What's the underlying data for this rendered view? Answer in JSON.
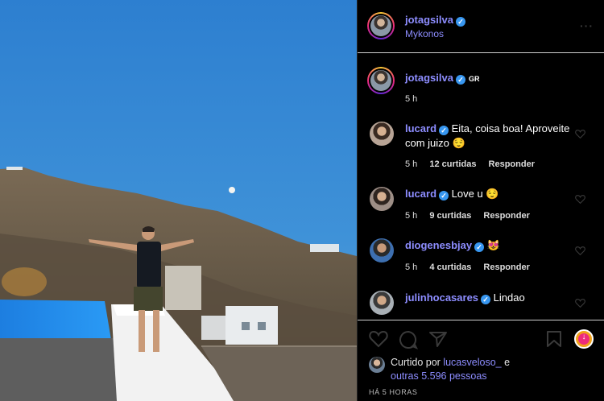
{
  "post": {
    "author": "jotagsilva",
    "location": "Mykonos",
    "more_icon": "more-horizontal-icon"
  },
  "caption": {
    "author": "jotagsilva",
    "badge": "GR",
    "time": "5 h"
  },
  "comments": [
    {
      "user": "lucard",
      "verified": true,
      "text": "Eita, coisa boa! Aproveite com juizo 😌",
      "time": "5 h",
      "likes": "12 curtidas",
      "reply": "Responder"
    },
    {
      "user": "lucard",
      "verified": true,
      "text": "Love u 😌",
      "time": "5 h",
      "likes": "9 curtidas",
      "reply": "Responder"
    },
    {
      "user": "diogenesbjay",
      "verified": true,
      "text": "😻",
      "time": "5 h",
      "likes": "4 curtidas",
      "reply": "Responder"
    },
    {
      "user": "julinhocasares",
      "verified": true,
      "text": "Lindao",
      "time": "",
      "likes": "",
      "reply": ""
    }
  ],
  "likes": {
    "prefix": "Curtido por",
    "user": "lucasveloso_",
    "conj": "e",
    "others": "outras 5.596 pessoas"
  },
  "timestamp": "HÁ 5 HORAS",
  "colors": {
    "username": "#8d8dff",
    "verified": "#3897f0",
    "sky": "#2f84d4"
  }
}
